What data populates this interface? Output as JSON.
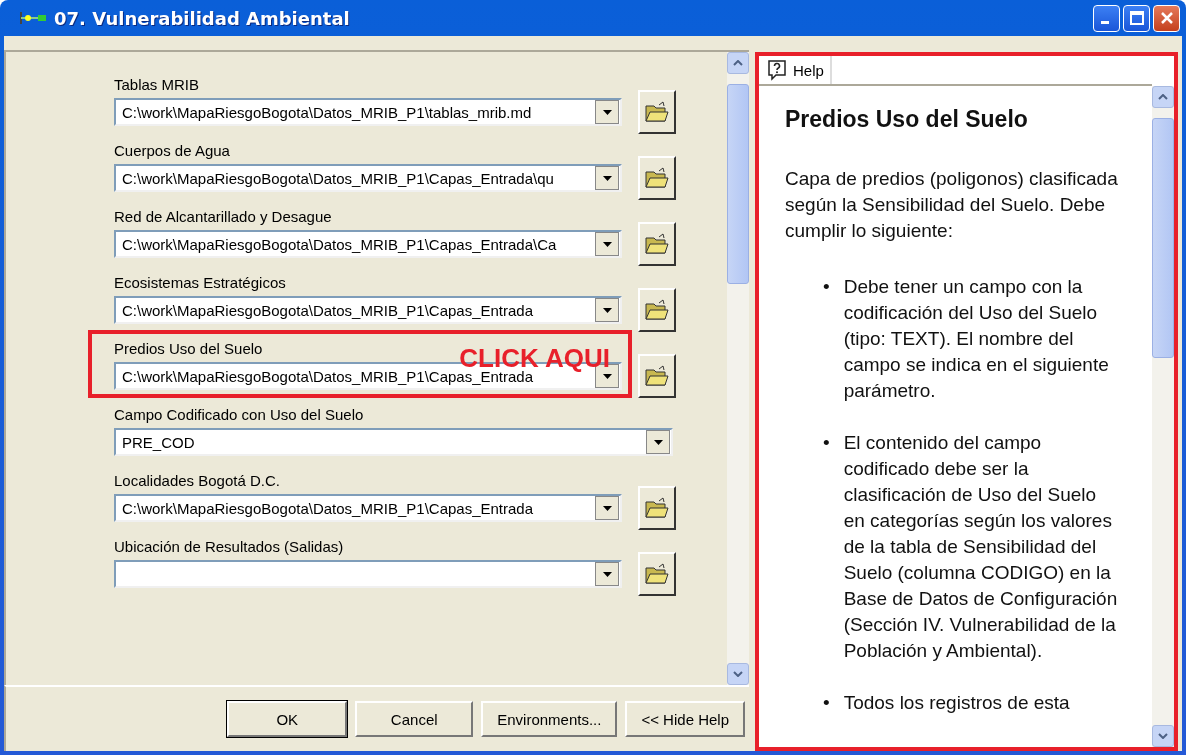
{
  "window": {
    "title": "07. Vulnerabilidad Ambiental"
  },
  "fields": [
    {
      "kind": "browse",
      "label": "Tablas MRIB",
      "value": "C:\\work\\MapaRiesgoBogota\\Datos_MRIB_P1\\tablas_mrib.md",
      "highlighted": false
    },
    {
      "kind": "browse",
      "label": "Cuerpos de Agua",
      "value": "C:\\work\\MapaRiesgoBogota\\Datos_MRIB_P1\\Capas_Entrada\\qu",
      "highlighted": false
    },
    {
      "kind": "browse",
      "label": "Red de Alcantarillado y Desague",
      "value": "C:\\work\\MapaRiesgoBogota\\Datos_MRIB_P1\\Capas_Entrada\\Ca",
      "highlighted": false
    },
    {
      "kind": "browse",
      "label": "Ecosistemas Estratégicos",
      "value": "C:\\work\\MapaRiesgoBogota\\Datos_MRIB_P1\\Capas_Entrada",
      "highlighted": false
    },
    {
      "kind": "browse",
      "label": "Predios Uso del Suelo",
      "value": "C:\\work\\MapaRiesgoBogota\\Datos_MRIB_P1\\Capas_Entrada",
      "highlighted": true,
      "callout": "CLICK AQUI"
    },
    {
      "kind": "choice",
      "label": "Campo Codificado con Uso del Suelo",
      "value": "PRE_COD",
      "highlighted": false
    },
    {
      "kind": "browse",
      "label": "Localidades Bogotá D.C.",
      "value": "C:\\work\\MapaRiesgoBogota\\Datos_MRIB_P1\\Capas_Entrada",
      "highlighted": false
    },
    {
      "kind": "browse",
      "label": "Ubicación de Resultados (Salidas)",
      "highlighted": false
    }
  ],
  "buttons": [
    {
      "label": "OK",
      "default": true
    },
    {
      "label": "Cancel",
      "default": false
    },
    {
      "label": "Environments...",
      "default": false
    },
    {
      "label": "<< Hide Help",
      "default": false
    }
  ],
  "help": {
    "tab": "Help",
    "highlighted": true,
    "title": "Predios Uso del Suelo",
    "intro": "Capa de predios (poligonos) clasificada según la Sensibilidad del Suelo. Debe cumplir lo siguiente:",
    "bullets": [
      {
        "marker": "•",
        "text": "Debe tener un campo con la codificación del Uso del Suelo (tipo: TEXT). El nombre del campo se indica en el siguiente parámetro."
      },
      {
        "marker": "•",
        "text": "El contenido del campo codificado debe ser la clasificación de Uso del Suelo en categorías según los valores de la tabla de Sensibilidad del Suelo (columna CODIGO) en la Base de Datos de Configuración (Sección IV. Vulnerabilidad de la Población y Ambiental)."
      },
      {
        "marker": "•",
        "text": "Todos los registros de esta"
      }
    ]
  }
}
